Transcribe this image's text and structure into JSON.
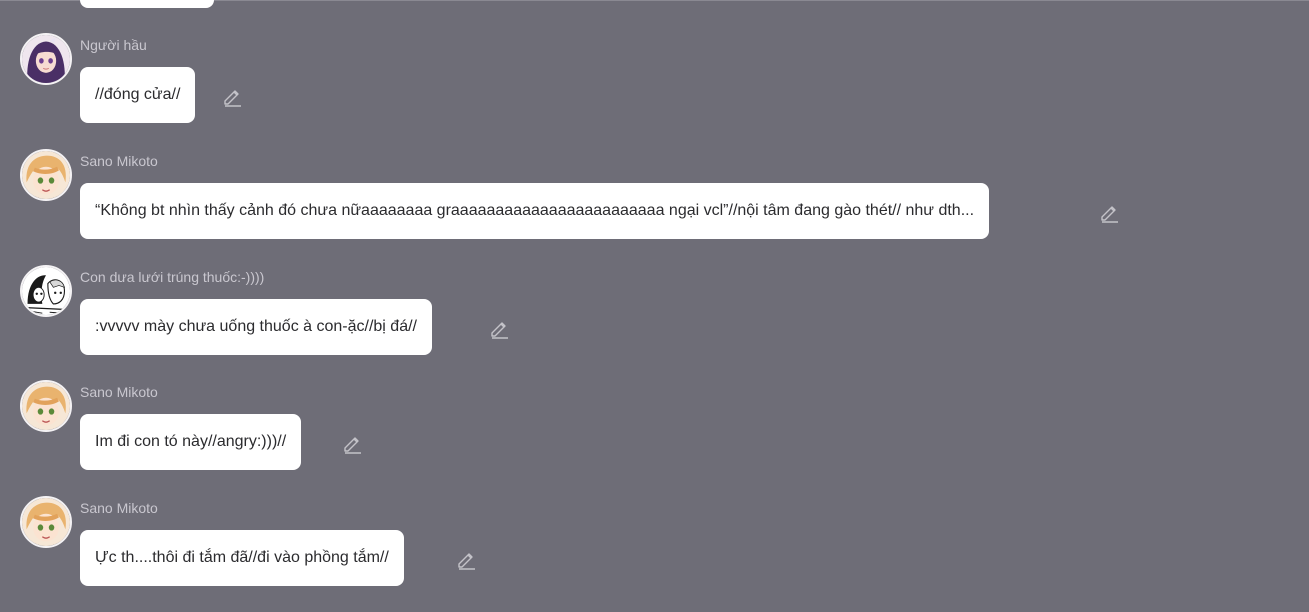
{
  "messages": [
    {
      "author": "Người hầu",
      "text": "//đóng cửa//",
      "avatar_icon": "purple-haired-girl-avatar",
      "edit_icon": "edit-pencil-icon"
    },
    {
      "author": "Sano Mikoto",
      "text": "“Không bt nhìn thấy cảnh đó chưa nữaaaaaaaa graaaaaaaaaaaaaaaaaaaaaaaa ngại vcl”//nội tâm đang gào thét// như dth...",
      "avatar_icon": "blonde-boy-avatar",
      "edit_icon": "edit-pencil-icon"
    },
    {
      "author": "Con dưa lưới trúng thuốc:-))))",
      "text": ":vvvvv mày chưa uống thuốc à con-ặc//bị đá//",
      "avatar_icon": "manga-panel-avatar",
      "edit_icon": "edit-pencil-icon"
    },
    {
      "author": "Sano Mikoto",
      "text": "Im đi con tó này//angry:)))//",
      "avatar_icon": "blonde-boy-avatar",
      "edit_icon": "edit-pencil-icon"
    },
    {
      "author": "Sano Mikoto",
      "text": "Ực th....thôi đi tắm đã//đi vào phồng tắm//",
      "avatar_icon": "blonde-boy-avatar",
      "edit_icon": "edit-pencil-icon"
    }
  ],
  "colors": {
    "background": "#6e6d77",
    "bubble": "#ffffff",
    "message_text": "#2b2b2e",
    "author_text": "#c9c7cf",
    "edit_icon": "#c4c3c9"
  }
}
